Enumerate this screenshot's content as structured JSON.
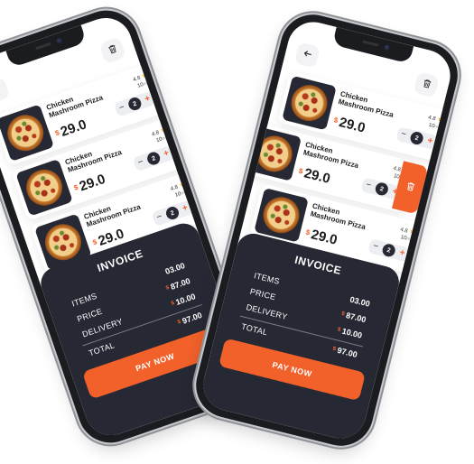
{
  "app": {
    "back_icon": "arrow-left-icon",
    "trash_icon": "trash-icon",
    "accent": "#f2612a",
    "dark": "#262833"
  },
  "cart_items": [
    {
      "name": "Chicken Mashroom Pizza",
      "currency": "$",
      "price": "29.0",
      "rating": "4.8",
      "time": "10",
      "time_unit": "min",
      "qty": "2",
      "minus": "−",
      "plus": "+"
    },
    {
      "name": "Chicken Mashroom Pizza",
      "currency": "$",
      "price": "29.0",
      "rating": "4.8",
      "time": "10",
      "time_unit": "min",
      "qty": "2",
      "minus": "−",
      "plus": "+"
    },
    {
      "name": "Chicken Mashroom Pizza",
      "currency": "$",
      "price": "29.0",
      "rating": "4.8",
      "time": "10",
      "time_unit": "min",
      "qty": "2",
      "minus": "−",
      "plus": "+"
    }
  ],
  "invoice": {
    "title": "INVOICE",
    "items_label": "ITEMS",
    "price_label": "PRICE",
    "delivery_label": "DELIVERY",
    "total_label": "TOTAL",
    "items_value": "03.00",
    "currency": "$",
    "price_value": "87.00",
    "delivery_value": "10.00",
    "total_value": "97.00"
  },
  "pay_button": "PAY NOW"
}
